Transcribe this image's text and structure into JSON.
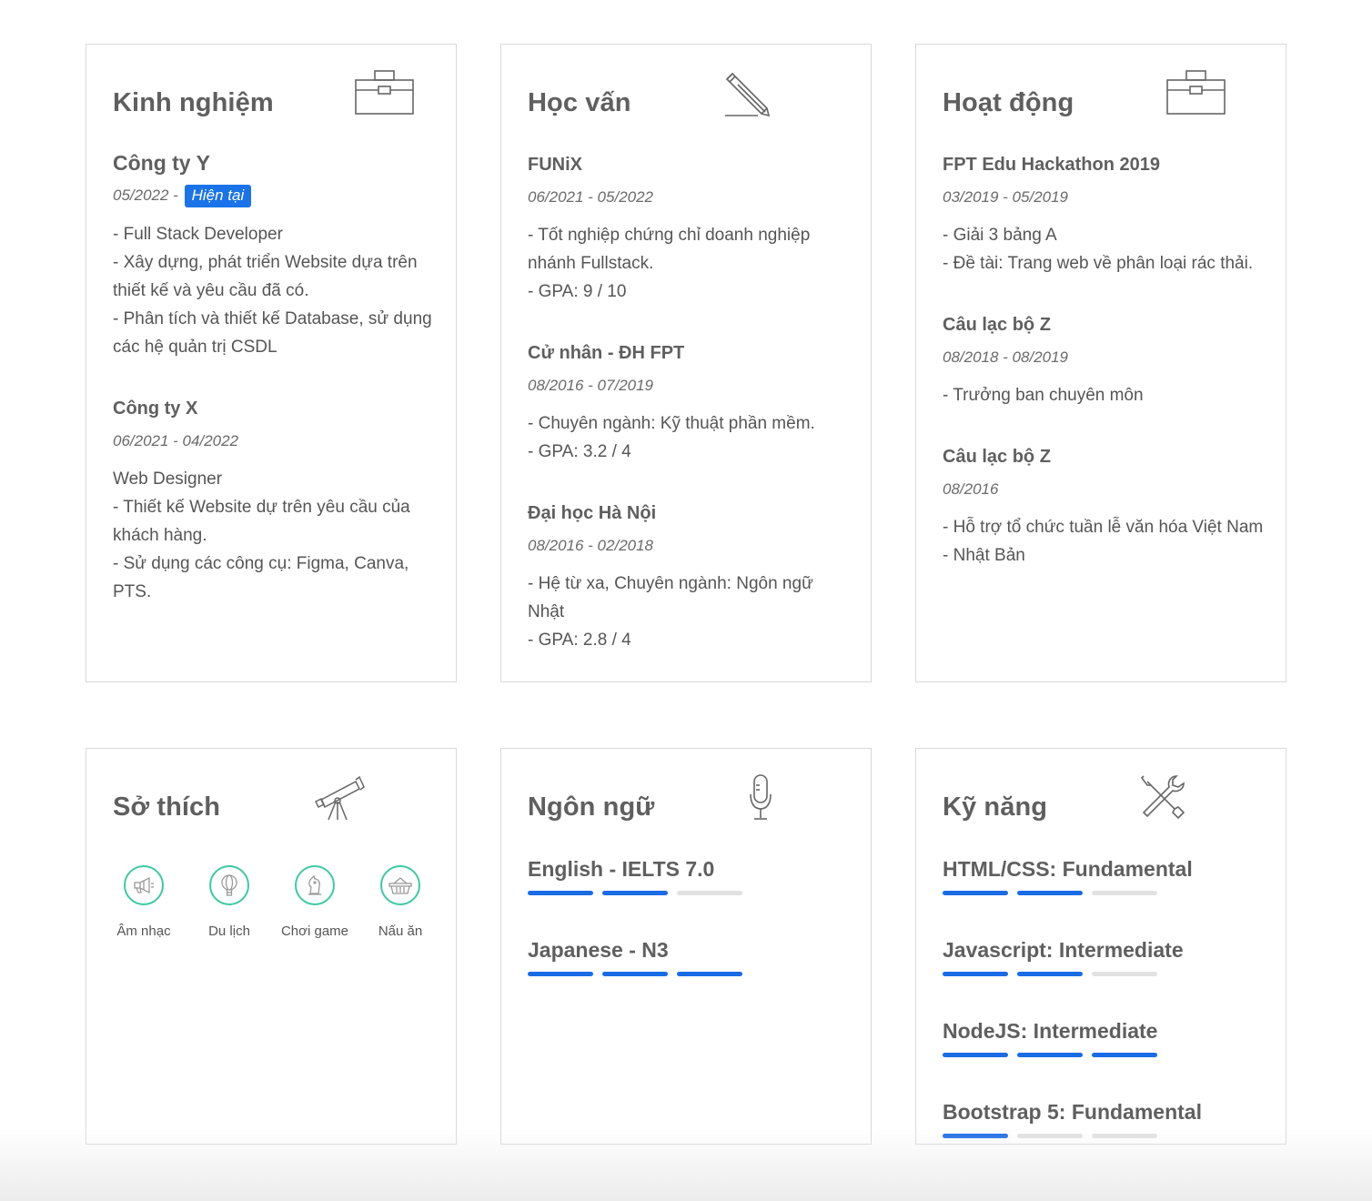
{
  "experience": {
    "title": "Kinh nghiệm",
    "icon": "briefcase-icon",
    "entries": [
      {
        "company": "Công ty Y",
        "date_start": "05/2022 -",
        "badge": "Hiện tại",
        "desc": [
          "- Full Stack Developer",
          "- Xây dựng, phát triển Website dựa trên thiết kế và yêu cầu đã có.",
          "- Phân tích và thiết kế Database, sử dụng các hệ quản trị CSDL"
        ]
      },
      {
        "company": "Công ty X",
        "date": "06/2021 - 04/2022",
        "desc": [
          "Web Designer",
          "- Thiết kế Website dự trên yêu cầu của khách hàng.",
          "- Sử dụng các công cụ: Figma, Canva, PTS."
        ]
      }
    ]
  },
  "education": {
    "title": "Học vấn",
    "icon": "pencil-icon",
    "entries": [
      {
        "school": "FUNiX",
        "date": "06/2021 - 05/2022",
        "desc": [
          "- Tốt nghiệp chứng chỉ doanh nghiệp nhánh Fullstack.",
          "- GPA: 9 / 10"
        ]
      },
      {
        "school": "Cử nhân - ĐH FPT",
        "date": "08/2016 - 07/2019",
        "desc": [
          "- Chuyên ngành: Kỹ thuật phần mềm.",
          "- GPA: 3.2 / 4"
        ]
      },
      {
        "school": "Đại học Hà Nội",
        "date": "08/2016 - 02/2018",
        "desc": [
          "- Hệ từ xa, Chuyên ngành: Ngôn ngữ Nhật",
          "- GPA: 2.8 / 4"
        ]
      }
    ]
  },
  "activities": {
    "title": "Hoạt động",
    "icon": "briefcase-icon",
    "entries": [
      {
        "name": "FPT Edu Hackathon 2019",
        "date": "03/2019 - 05/2019",
        "desc": [
          "- Giải 3 bảng A",
          "- Đề tài: Trang web về phân loại rác thải."
        ]
      },
      {
        "name": "Câu lạc bộ Z",
        "date": "08/2018 - 08/2019",
        "desc": [
          "- Trưởng ban chuyên môn"
        ]
      },
      {
        "name": "Câu lạc bộ Z",
        "date": "08/2016",
        "desc": [
          "- Hỗ trợ tổ chức tuần lễ văn hóa Việt Nam - Nhật Bản"
        ]
      }
    ]
  },
  "hobbies": {
    "title": "Sở thích",
    "icon": "telescope-icon",
    "accent": "#3dc9a2",
    "items": [
      {
        "label": "Âm nhạc",
        "icon": "megaphone-icon"
      },
      {
        "label": "Du lịch",
        "icon": "balloon-icon"
      },
      {
        "label": "Chơi game",
        "icon": "chess-knight-icon"
      },
      {
        "label": "Nấu ăn",
        "icon": "basket-icon"
      }
    ]
  },
  "languages": {
    "title": "Ngôn ngữ",
    "icon": "microphone-icon",
    "items": [
      {
        "name": "English - IELTS 7.0",
        "level": 2,
        "max": 3
      },
      {
        "name": "Japanese - N3",
        "level": 3,
        "max": 3
      }
    ]
  },
  "skills": {
    "title": "Kỹ năng",
    "icon": "tools-icon",
    "bar_color": "#1a6be6",
    "items": [
      {
        "name": "HTML/CSS: Fundamental",
        "level": 2,
        "max": 3
      },
      {
        "name": "Javascript: Intermediate",
        "level": 2,
        "max": 3
      },
      {
        "name": "NodeJS: Intermediate",
        "level": 3,
        "max": 3
      },
      {
        "name": "Bootstrap 5: Fundamental",
        "level": 1,
        "max": 3
      }
    ]
  }
}
